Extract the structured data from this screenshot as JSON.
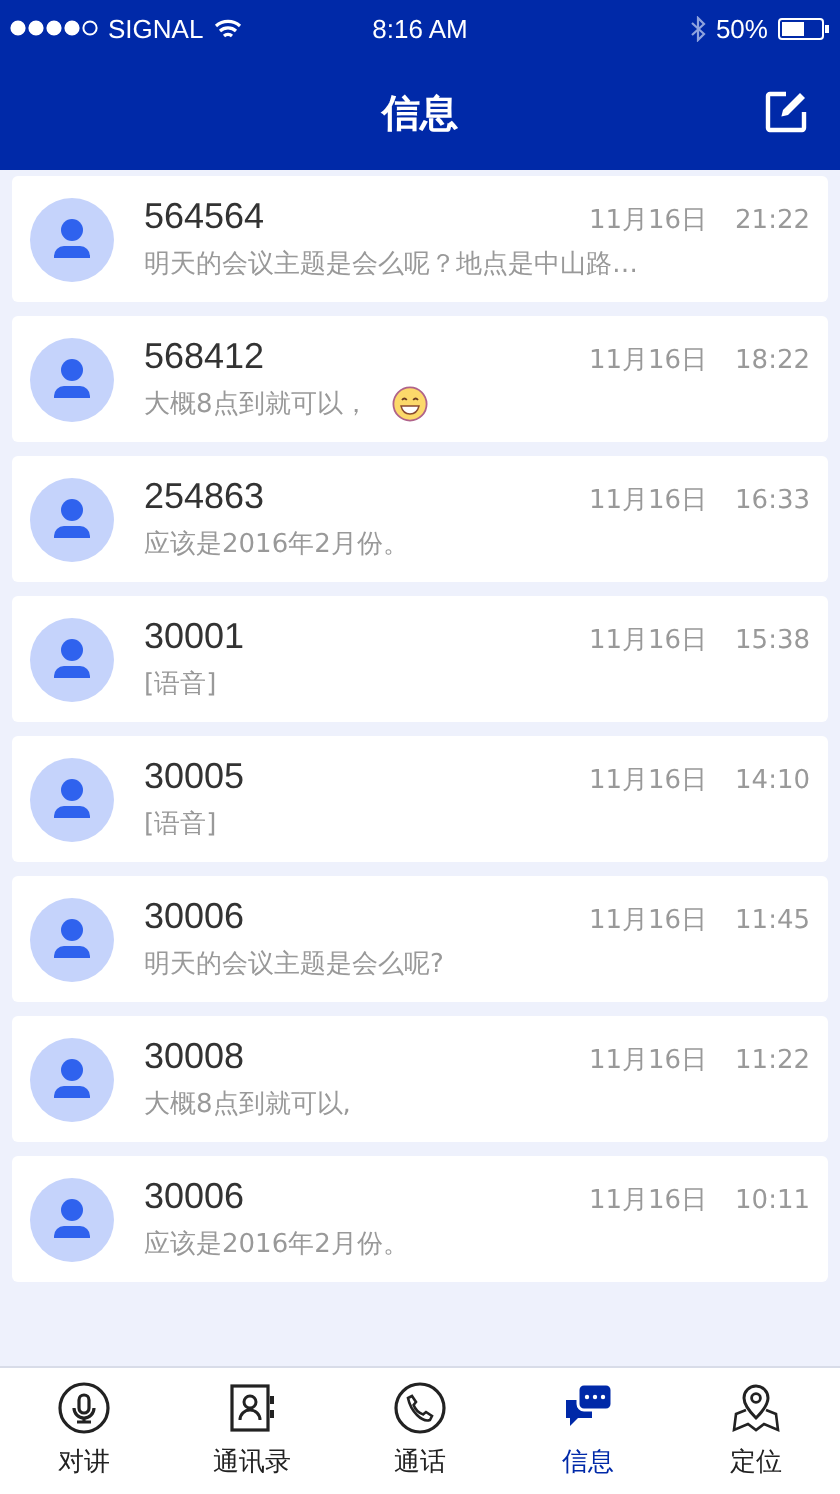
{
  "status_bar": {
    "carrier": "SIGNAL",
    "time": "8:16 AM",
    "battery": "50%"
  },
  "header": {
    "title": "信息"
  },
  "messages": [
    {
      "name": "564564",
      "date": "11月16日",
      "time": "21:22",
      "preview": "明天的会议主题是会么呢？地点是中山路…",
      "emoji": false
    },
    {
      "name": "568412",
      "date": "11月16日",
      "time": "18:22",
      "preview": "大概8点到就可以，",
      "emoji": true
    },
    {
      "name": "254863",
      "date": "11月16日",
      "time": "16:33",
      "preview": "应该是2016年2月份。",
      "emoji": false
    },
    {
      "name": "30001",
      "date": "11月16日",
      "time": "15:38",
      "preview": "[语音]",
      "emoji": false
    },
    {
      "name": "30005",
      "date": "11月16日",
      "time": "14:10",
      "preview": "[语音]",
      "emoji": false
    },
    {
      "name": "30006",
      "date": "11月16日",
      "time": "11:45",
      "preview": "明天的会议主题是会么呢?",
      "emoji": false
    },
    {
      "name": "30008",
      "date": "11月16日",
      "time": "11:22",
      "preview": "大概8点到就可以,",
      "emoji": false
    },
    {
      "name": "30006",
      "date": "11月16日",
      "time": "10:11",
      "preview": "应该是2016年2月份。",
      "emoji": false
    }
  ],
  "tab_bar": [
    {
      "label": "对讲",
      "kind": "mic",
      "selected": false
    },
    {
      "label": "通讯录",
      "kind": "contacts",
      "selected": false
    },
    {
      "label": "通话",
      "kind": "phone",
      "selected": false
    },
    {
      "label": "信息",
      "kind": "chat",
      "selected": true
    },
    {
      "label": "定位",
      "kind": "location",
      "selected": false
    }
  ]
}
